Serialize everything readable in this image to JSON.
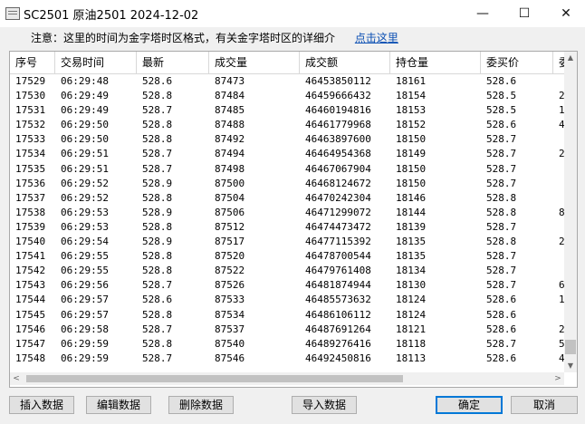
{
  "window": {
    "title": "SC2501 原油2501 2024-12-02",
    "min": "—",
    "max": "☐",
    "close": "✕"
  },
  "notice": {
    "text": "注意：这里的时间为金字塔时区格式，有关金字塔时区的详细介",
    "link": "点击这里"
  },
  "table": {
    "headers": [
      "序号",
      "交易时间",
      "最新",
      "成交量",
      "成交额",
      "持仓量",
      "委买价",
      "委"
    ],
    "rows": [
      [
        "17529",
        "06:29:48",
        "528.6",
        "87473",
        "46453850112",
        "18161",
        "528.6",
        ""
      ],
      [
        "17530",
        "06:29:49",
        "528.8",
        "87484",
        "46459666432",
        "18154",
        "528.5",
        "2"
      ],
      [
        "17531",
        "06:29:49",
        "528.7",
        "87485",
        "46460194816",
        "18153",
        "528.5",
        "1"
      ],
      [
        "17532",
        "06:29:50",
        "528.8",
        "87488",
        "46461779968",
        "18152",
        "528.6",
        "4"
      ],
      [
        "17533",
        "06:29:50",
        "528.8",
        "87492",
        "46463897600",
        "18150",
        "528.7",
        ""
      ],
      [
        "17534",
        "06:29:51",
        "528.7",
        "87494",
        "46464954368",
        "18149",
        "528.7",
        "2"
      ],
      [
        "17535",
        "06:29:51",
        "528.7",
        "87498",
        "46467067904",
        "18150",
        "528.7",
        ""
      ],
      [
        "17536",
        "06:29:52",
        "528.9",
        "87500",
        "46468124672",
        "18150",
        "528.7",
        ""
      ],
      [
        "17537",
        "06:29:52",
        "528.8",
        "87504",
        "46470242304",
        "18146",
        "528.8",
        ""
      ],
      [
        "17538",
        "06:29:53",
        "528.9",
        "87506",
        "46471299072",
        "18144",
        "528.8",
        "8"
      ],
      [
        "17539",
        "06:29:53",
        "528.8",
        "87512",
        "46474473472",
        "18139",
        "528.7",
        ""
      ],
      [
        "17540",
        "06:29:54",
        "528.9",
        "87517",
        "46477115392",
        "18135",
        "528.8",
        "2"
      ],
      [
        "17541",
        "06:29:55",
        "528.8",
        "87520",
        "46478700544",
        "18135",
        "528.7",
        ""
      ],
      [
        "17542",
        "06:29:55",
        "528.8",
        "87522",
        "46479761408",
        "18134",
        "528.7",
        ""
      ],
      [
        "17543",
        "06:29:56",
        "528.7",
        "87526",
        "46481874944",
        "18130",
        "528.7",
        "6"
      ],
      [
        "17544",
        "06:29:57",
        "528.6",
        "87533",
        "46485573632",
        "18124",
        "528.6",
        "1"
      ],
      [
        "17545",
        "06:29:57",
        "528.8",
        "87534",
        "46486106112",
        "18124",
        "528.6",
        ""
      ],
      [
        "17546",
        "06:29:58",
        "528.7",
        "87537",
        "46487691264",
        "18121",
        "528.6",
        "2"
      ],
      [
        "17547",
        "06:29:59",
        "528.8",
        "87540",
        "46489276416",
        "18118",
        "528.7",
        "5"
      ],
      [
        "17548",
        "06:29:59",
        "528.7",
        "87546",
        "46492450816",
        "18113",
        "528.6",
        "4"
      ]
    ]
  },
  "scrollbar": {
    "up": "▲",
    "down": "▼",
    "left": "<",
    "right": ">"
  },
  "buttons": {
    "insert": "插入数据",
    "edit": "编辑数据",
    "delete": "删除数据",
    "import": "导入数据",
    "ok": "确定",
    "cancel": "取消"
  }
}
